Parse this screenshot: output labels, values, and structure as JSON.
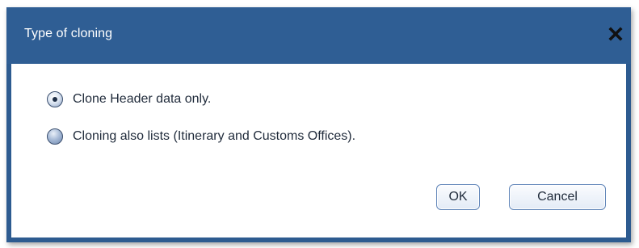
{
  "dialog": {
    "title": "Type of cloning",
    "close_icon": "close-icon",
    "options": [
      {
        "label": "Clone Header data only.",
        "selected": true
      },
      {
        "label": "Cloning also lists (Itinerary and Customs Offices).",
        "selected": false
      }
    ],
    "ok_label": "OK",
    "cancel_label": "Cancel"
  },
  "colors": {
    "titlebar": "#2f5e94",
    "frame": "#2d5b90",
    "body": "#ffffff",
    "text": "#1f2a3a"
  }
}
